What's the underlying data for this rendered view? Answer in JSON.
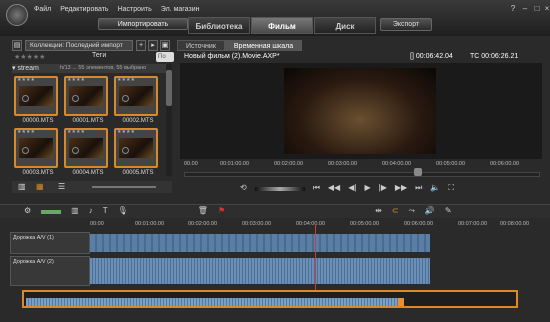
{
  "menu": [
    "Файл",
    "Редактировать",
    "Настроить",
    "Эл. магазин"
  ],
  "import_label": "Импортировать",
  "tabs": [
    "Библиотека",
    "Фильм",
    "Диск"
  ],
  "export_label": "Экспорт",
  "library": {
    "collection": "Коллекции: Последний импорт",
    "tags_label": "Теги",
    "stream_label": "stream",
    "counter": "h/13 ... 55 элементов, 55 выбрано",
    "search_placeholder": "По",
    "thumbs": [
      "00000.MTS",
      "00001.MTS",
      "00002.MTS",
      "00003.MTS",
      "00004.MTS",
      "00005.MTS"
    ]
  },
  "player": {
    "tabs": [
      "Источник",
      "Временная шкала"
    ],
    "title": "Новый фильм (2).Movie.AXP*",
    "timecode1": "[] 00:06:42.04",
    "timecode2": "TC 00:06:26.21",
    "ruler": [
      "00.00",
      "00:01:00.00",
      "00:02:00.00",
      "00:03:00.00",
      "00:04:00.00",
      "00:05:00.00",
      "00:06:00.00"
    ]
  },
  "timeline": {
    "ruler": [
      "00:00",
      "00:01:00.00",
      "00:02:00.00",
      "00:03:00.00",
      "00:04:00.00",
      "00:05:00.00",
      "00:06:00.00",
      "00:07:00.00",
      "00:08:00.00"
    ],
    "track1": "Дорожка А/V (1)",
    "track2": "Дорожка А/V (2)"
  }
}
